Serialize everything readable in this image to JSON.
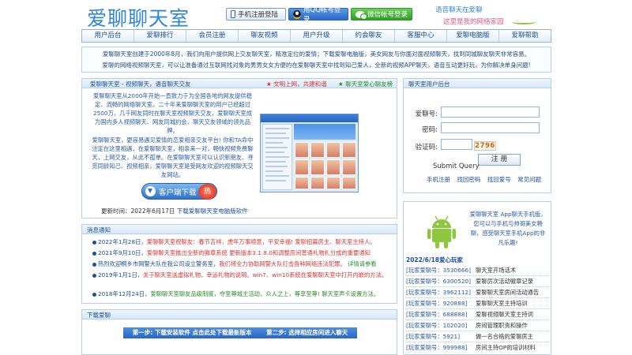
{
  "header": {
    "logo": "爱聊聊天室",
    "phone_register": "手机注册登陆",
    "qq_login": "用QQ帐号登录",
    "wechat_login": "微信帐号登录",
    "slogan_line1": "语音聊天在爱聊",
    "slogan_line2": "这里是我的网络家园"
  },
  "nav": [
    "用户后台",
    "爱聊排行",
    "会员注册",
    "聊友视频",
    "用户升级",
    "约会聊友",
    "客服中心",
    "爱聊电脑版",
    "爱聊帮助"
  ],
  "intro": {
    "line1": "爱聊聊天室创建于2000年8月，我们向用户提供网上交友聊天室，精准定位的爱情；下载爱聊电脑版，美女网友与你面对面视频聊天，找到同城聊友聊天非常容易。",
    "line2": "爱聊的网络视频聊天室，可以让准备通过互联网找对象的男男女女方便的在爱聊聊天室中找到知己爱人，全新的视频APP聊天，语音互动更好玩，为你解决单身问题!"
  },
  "left": {
    "title": "爱聊聊天室 - 视频聊天，语音聊天交友",
    "extra1": "文明上网，共建和谐",
    "extra2": "聊天室爱心聊友榜",
    "text1": "爱聊聊天室从2000年开始一直致力于为全国各地的网友提供稳定、流畅的网络聊天室。二十年来爱聊聊天室的用户已经超过2500万，几千网友同时在聊天室视频聊天交友，爱聊聊天室成为国内多人视频聊天、网友同城约会、聊天交友领域的领先品牌。",
    "text2": "爱聊聊天室，更容易遇见爱情的恋爱相亲交友平台! 你和TA命中注定在这里相遇，在爱聊聊天室，相亲来一对，畅快视频免费聊天，上网交友，从此不孤单。在爱聊聊天室可以认识新朋友、寻觅同龄知己、视频相亲，爱聊聊天室是受网友欢迎的视频聊天交友网站。",
    "download_button": "客户端下载",
    "download_badge": "热",
    "update_label": "更新时间：2022年6月17日",
    "update_link": "下载爱聊聊天室电脑版软件"
  },
  "news": {
    "title": "消息通知",
    "items": [
      {
        "date": "2022年1月28日，",
        "text": "爱聊聊天室祝聊友：春节吉祥，虎年万事顺意，平安幸福!",
        "extra": "爱聊招募房主、聊天室主持人。",
        "color": "nr"
      },
      {
        "date": "2021年9月10日，",
        "text": "爱聊聊天室推出全新的徽章系统 更新版本3.1.8.0和调整房间普通礼物礼分成的重要通知",
        "extra": "",
        "color": "nr"
      },
      {
        "date": "热烈欢迎桐乡市网警大队在我公司设立警务室，",
        "text": "我们将全力协助网警大队打击各种网络违法犯罪。",
        "extra": "详情请参看",
        "color": "nr"
      },
      {
        "date": "2019年1月1日，",
        "text": "关于聊天室送虚拟礼物，幸运礼物的说明。win7、win10系统在爱聊聊天室中打开内嵌的方法。",
        "extra": "",
        "color": "nr"
      },
      {
        "date": "2018年12月24日，",
        "text": "爱聊聊天室聊友品级制度，夺至尊城主活动，众人之上，尊享至尊!",
        "extra": "聊天室声卡设置方法。",
        "color": "ng"
      }
    ]
  },
  "download_section": {
    "title": "下载爱聊",
    "step1": "第一步: 下载安装软件 点击此处下载最新版本",
    "step2": "第二步: 选择相应房间进入聊天"
  },
  "login": {
    "title": "聊天室用户后台",
    "account_label": "爱聊号:",
    "password_label": "密码:",
    "captcha_label": "验证码:",
    "captcha_value": "2796",
    "submit_label": "Submit Query",
    "login_button": "注 册",
    "links": [
      "手机注册",
      "找回密码",
      "找回爱号",
      "常见问题"
    ]
  },
  "android": {
    "text": "爱聊聊天室 App聊天手机版，您可以与手机与帅哥美女畅聊，感受聊天室手机App的非凡乐趣!",
    "ranking_title": "2022/6/18爱心玩家",
    "ranking": [
      {
        "player": "[玩家爱聊号：3530666]",
        "desc": "聊天室开场话术"
      },
      {
        "player": "[玩家爱聊号：6300520]",
        "desc": "爱聊厉次活动徽章记录"
      },
      {
        "player": "[玩家爱聊号：3962112]",
        "desc": "爱聊聊天室房间活动通告"
      },
      {
        "player": "[玩家爱聊号：920888]",
        "desc": "爱聊聊天室主持培训"
      },
      {
        "player": "[玩家爱聊号：688888]",
        "desc": "爱聊视频聊天室主持词"
      },
      {
        "player": "[玩家爱聊号：102020]",
        "desc": "房间管理职责和操作"
      },
      {
        "player": "[玩家爱聊号：5921]",
        "desc": "做一名合格的爱聊房主"
      },
      {
        "player": "[玩家爱聊号：999988]",
        "desc": "房间主持OP的培训材料"
      }
    ]
  },
  "colors": {
    "accent": "#2f85d9",
    "nav_text": "#1a4f9c",
    "border": "#b5cfe9",
    "red": "#dd3333",
    "green": "#2a8f2a"
  }
}
